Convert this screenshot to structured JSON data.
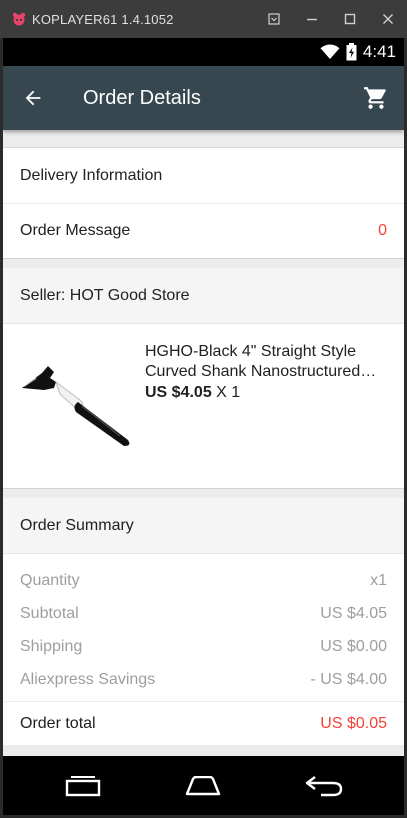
{
  "emulator": {
    "title": "KOPLAYER61 1.4.1052",
    "controls": [
      "minimize-to-tray",
      "minimize",
      "maximize",
      "close"
    ]
  },
  "status_bar": {
    "time": "4:41"
  },
  "app_bar": {
    "title": "Order Details"
  },
  "sections": {
    "delivery_info": "Delivery Information",
    "order_message_label": "Order Message",
    "order_message_count": "0"
  },
  "seller": {
    "label": "Seller: HOT Good Store"
  },
  "product": {
    "name": "HGHO-Black 4\" Straight Style Curved Shank Nanostructured…",
    "price": "US $4.05",
    "quantity": "X 1"
  },
  "summary": {
    "title": "Order Summary",
    "rows": [
      {
        "label": "Quantity",
        "value": "x1"
      },
      {
        "label": "Subtotal",
        "value": "US $4.05"
      },
      {
        "label": "Shipping",
        "value": "US $0.00"
      },
      {
        "label": "Aliexpress Savings",
        "value": "- US $4.00"
      }
    ],
    "total_label": "Order total",
    "total_value": "US $0.05"
  },
  "colors": {
    "app_bar": "#37474f",
    "accent_red": "#f44336",
    "muted_text": "#9e9e9e"
  }
}
